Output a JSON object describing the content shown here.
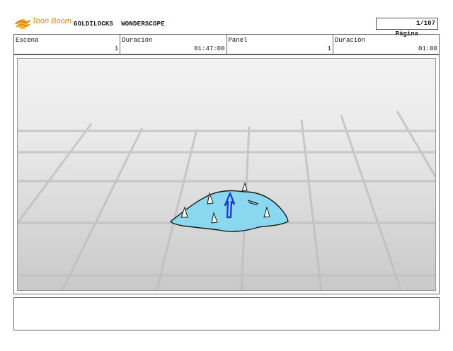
{
  "header": {
    "logo_text": "Toon Boom",
    "project_title": "GOLDILOCKS  WONDERSCOPE",
    "page_label": "Página",
    "page_number": "1/107"
  },
  "info": {
    "scene_label": "Escena",
    "scene_value": "1",
    "duration_label": "Duración",
    "duration_value": "01:47:00",
    "panel_label": "Panel",
    "panel_value": "1",
    "panel_duration_label": "Duración",
    "panel_duration_value": "01:00"
  },
  "colors": {
    "logo_orange": "#f0a020",
    "blob_fill": "#8ad8f0",
    "arrow_blue": "#1f3fd6",
    "grid_line": "#bdbdbd"
  },
  "notes": {
    "text": ""
  }
}
